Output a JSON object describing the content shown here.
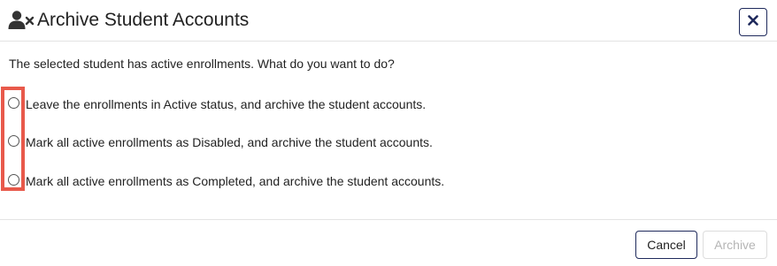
{
  "dialog": {
    "title": "Archive Student Accounts",
    "title_icon": "user-remove-icon",
    "close_icon": "close-icon",
    "message": "The selected student has active enrollments. What do you want to do?",
    "options": [
      {
        "label": "Leave the enrollments in Active status, and archive the student accounts.",
        "selected": false
      },
      {
        "label": "Mark all active enrollments as Disabled, and archive the student accounts.",
        "selected": false
      },
      {
        "label": "Mark all active enrollments as Completed, and archive the student accounts.",
        "selected": false
      }
    ],
    "buttons": {
      "cancel": "Cancel",
      "archive": "Archive",
      "archive_disabled": true
    }
  },
  "colors": {
    "accent": "#1f2a5c",
    "highlight": "#e8594b",
    "disabled_text": "#b5b5b5",
    "divider": "#e3e3e3"
  }
}
